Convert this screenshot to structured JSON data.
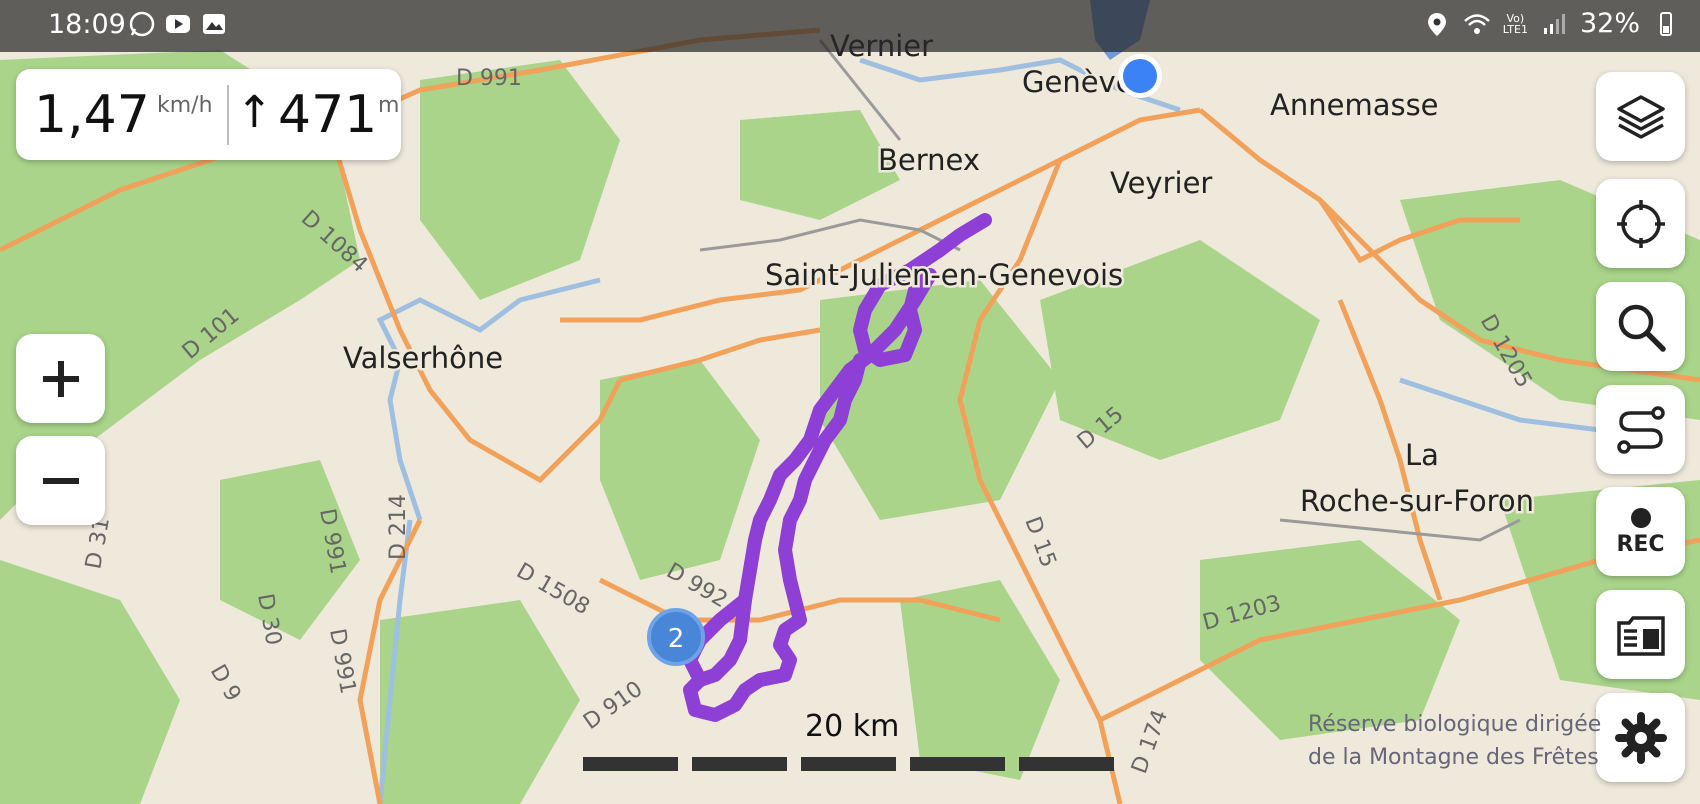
{
  "status_bar": {
    "time": "18:09",
    "battery": "32%",
    "network": "LTE1",
    "network_top": "Vo)",
    "app_icons": [
      "whatsapp-icon",
      "youtube-icon",
      "gallery-icon"
    ],
    "right_icons": [
      "location-icon",
      "wifi-icon",
      "signal-icon",
      "battery-icon"
    ]
  },
  "speed_panel": {
    "speed": "1,47",
    "speed_unit": "km/h",
    "altitude_arrow": "↑",
    "altitude": "471",
    "altitude_unit": "m"
  },
  "map": {
    "places": [
      {
        "name": "Vernier"
      },
      {
        "name": "Genève"
      },
      {
        "name": "Annemasse"
      },
      {
        "name": "Bernex"
      },
      {
        "name": "Veyrier"
      },
      {
        "name": "Saint-Julien-en-Genevois"
      },
      {
        "name": "Valserhône"
      },
      {
        "name": "La"
      },
      {
        "name": "Roche-sur-Foron"
      }
    ],
    "roads": [
      "D 991",
      "D 1084",
      "D 101",
      "D 1205",
      "D 15",
      "D 15",
      "D 214",
      "D 31",
      "D 991",
      "D 991",
      "D 30",
      "D 9",
      "D 1508",
      "D 992",
      "D 910",
      "D 1203",
      "D 174"
    ],
    "cluster_count": "2",
    "track_color": "#8e3fd6",
    "location_color": "#3b82f6"
  },
  "scale": {
    "label": "20 km"
  },
  "reserve": {
    "line1": "Réserve biologique dirigée",
    "line2": "de la Montagne des Frêtes"
  },
  "controls": {
    "zoom_in": "+",
    "zoom_out": "−",
    "rec_label": "REC",
    "right_buttons": [
      "layers-icon",
      "locate-icon",
      "search-icon",
      "route-icon",
      "record-icon",
      "map-download-icon",
      "settings-icon"
    ]
  },
  "colors": {
    "water": "#9fbfe0",
    "forest": "#a9d48a",
    "road": "#f2a15a",
    "land": "#efe9dc"
  }
}
